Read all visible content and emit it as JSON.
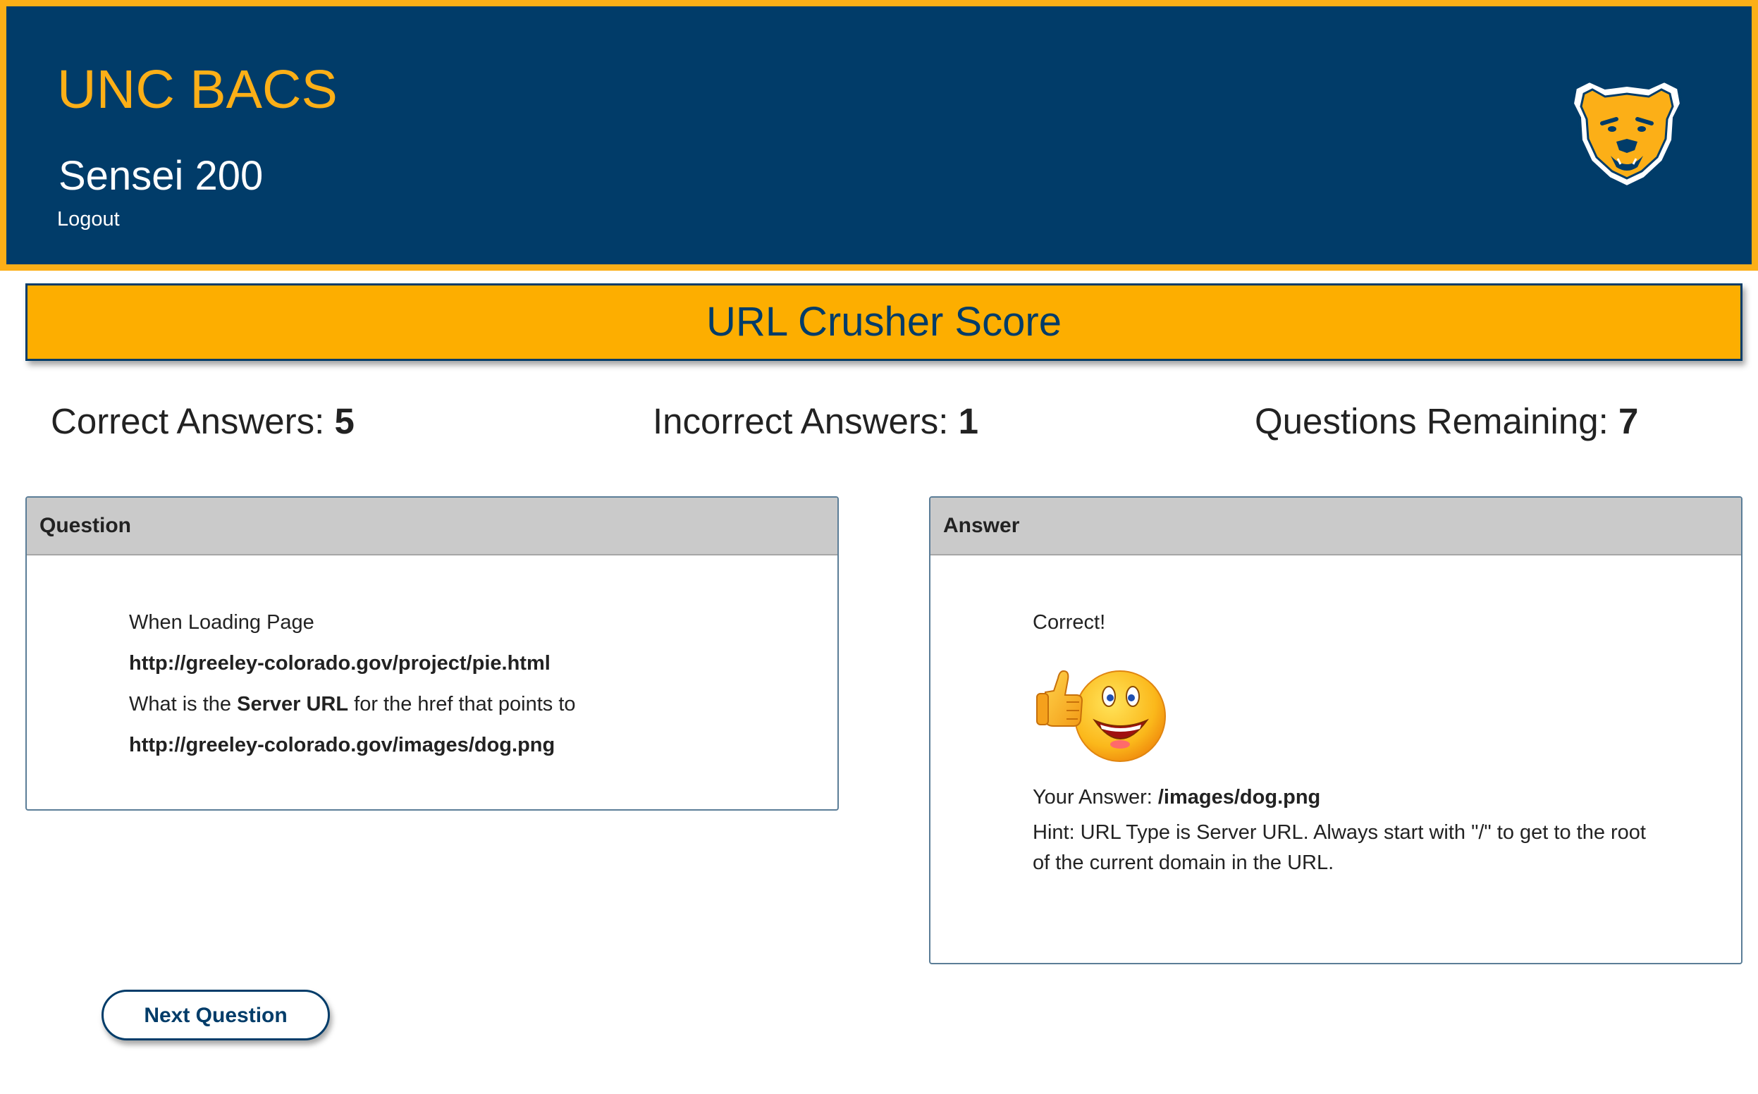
{
  "header": {
    "title": "UNC BACS",
    "subtitle": "Sensei 200",
    "logout_label": "Logout"
  },
  "banner": {
    "title": "URL Crusher Score"
  },
  "stats": {
    "correct_label": "Correct Answers:",
    "correct_value": "5",
    "incorrect_label": "Incorrect Answers:",
    "incorrect_value": "1",
    "remaining_label": "Questions Remaining:",
    "remaining_value": "7"
  },
  "question": {
    "heading": "Question",
    "line1": "When Loading Page",
    "page_url": "http://greeley-colorado.gov/project/pie.html",
    "line3_prefix": "What is the ",
    "line3_bold": "Server URL",
    "line3_suffix": " for the href that points to",
    "target_url": "http://greeley-colorado.gov/images/dog.png"
  },
  "answer": {
    "heading": "Answer",
    "result": "Correct!",
    "your_answer_label": "Your Answer: ",
    "your_answer_value": "/images/dog.png",
    "hint": "Hint: URL Type is Server URL. Always start with \"/\" to get to the root of the current domain in the URL."
  },
  "actions": {
    "next_label": "Next Question"
  },
  "colors": {
    "navy": "#013c69",
    "gold": "#fcaf17",
    "card_header": "#cacaca"
  },
  "icons": {
    "logo": "bear-logo-icon",
    "emoji": "thumbs-up-smiley-icon"
  }
}
